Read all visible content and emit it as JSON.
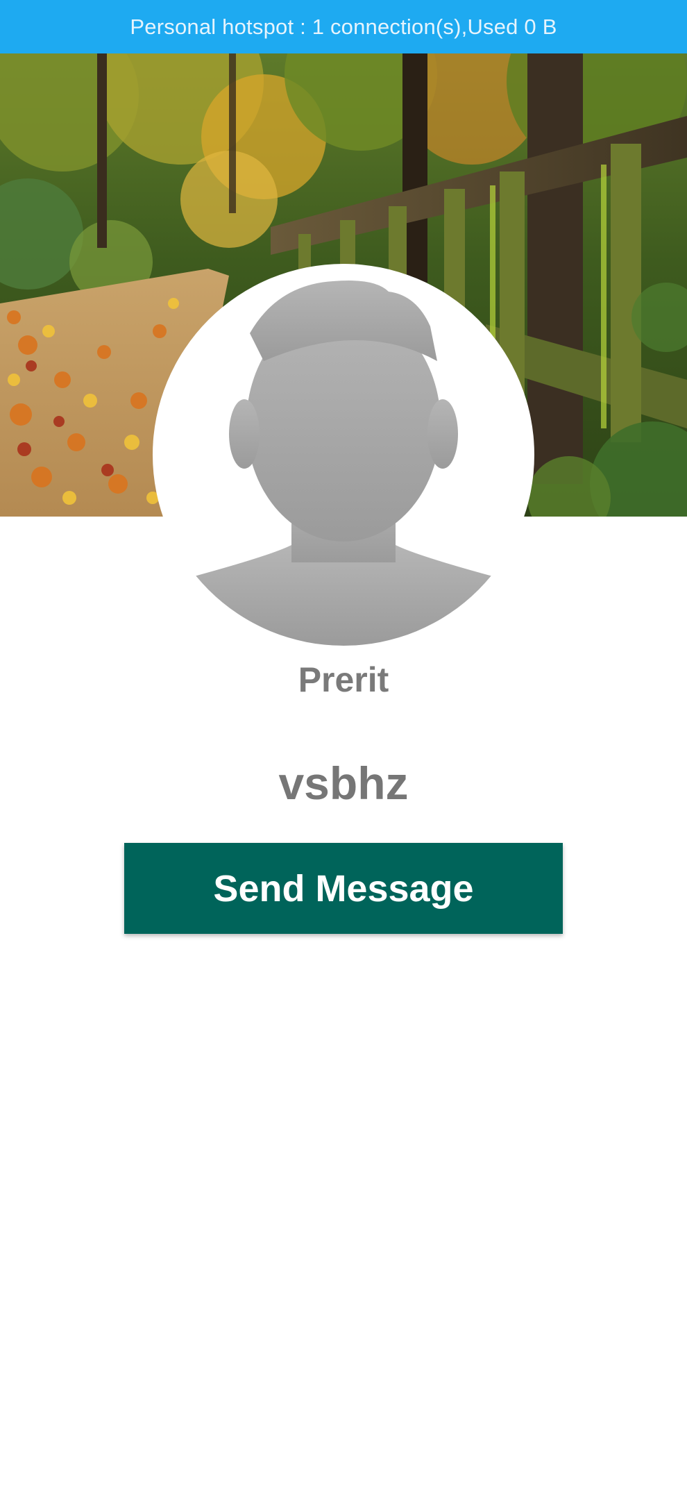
{
  "status_bar": {
    "text": "Personal hotspot : 1 connection(s),Used  0 B",
    "background": "#1eaaf1"
  },
  "cover": {
    "icon": "autumn-park-cover-image"
  },
  "avatar": {
    "icon": "default-person-avatar-icon"
  },
  "profile": {
    "name": "Prerit",
    "status": "vsbhz"
  },
  "actions": {
    "send_message_label": "Send Message",
    "accent": "#00645a"
  }
}
